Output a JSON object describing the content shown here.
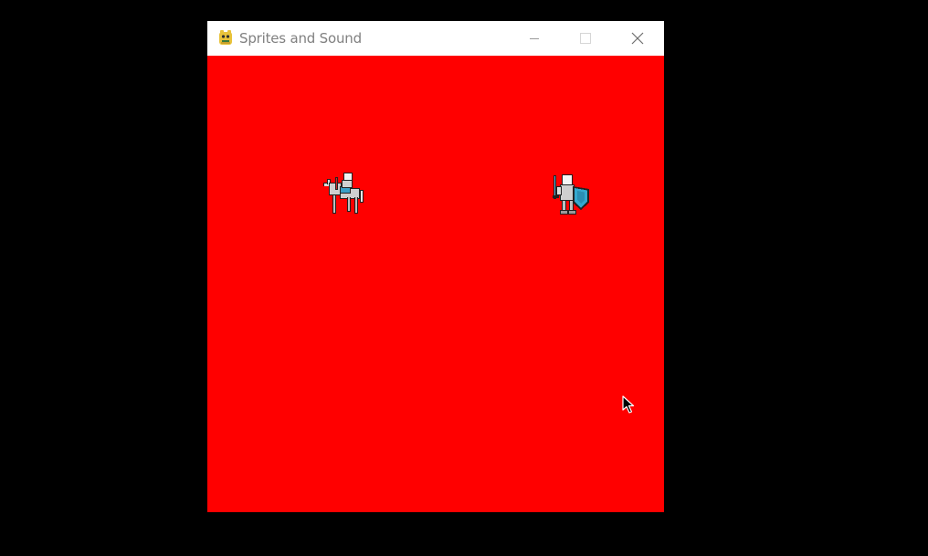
{
  "window": {
    "title": "Sprites and Sound",
    "app_icon": "pygame-snake-icon",
    "controls": {
      "minimize_icon": "minimize-icon",
      "maximize_icon": "maximize-icon",
      "close_icon": "close-icon"
    }
  },
  "canvas": {
    "background_color": "#ff0000",
    "sprites": [
      {
        "name": "knight-on-horse-sprite",
        "description_icon": "mounted-knight"
      },
      {
        "name": "knight-with-shield-sprite",
        "description_icon": "shield-knight"
      }
    ]
  },
  "desktop": {
    "background_color": "#000000"
  }
}
